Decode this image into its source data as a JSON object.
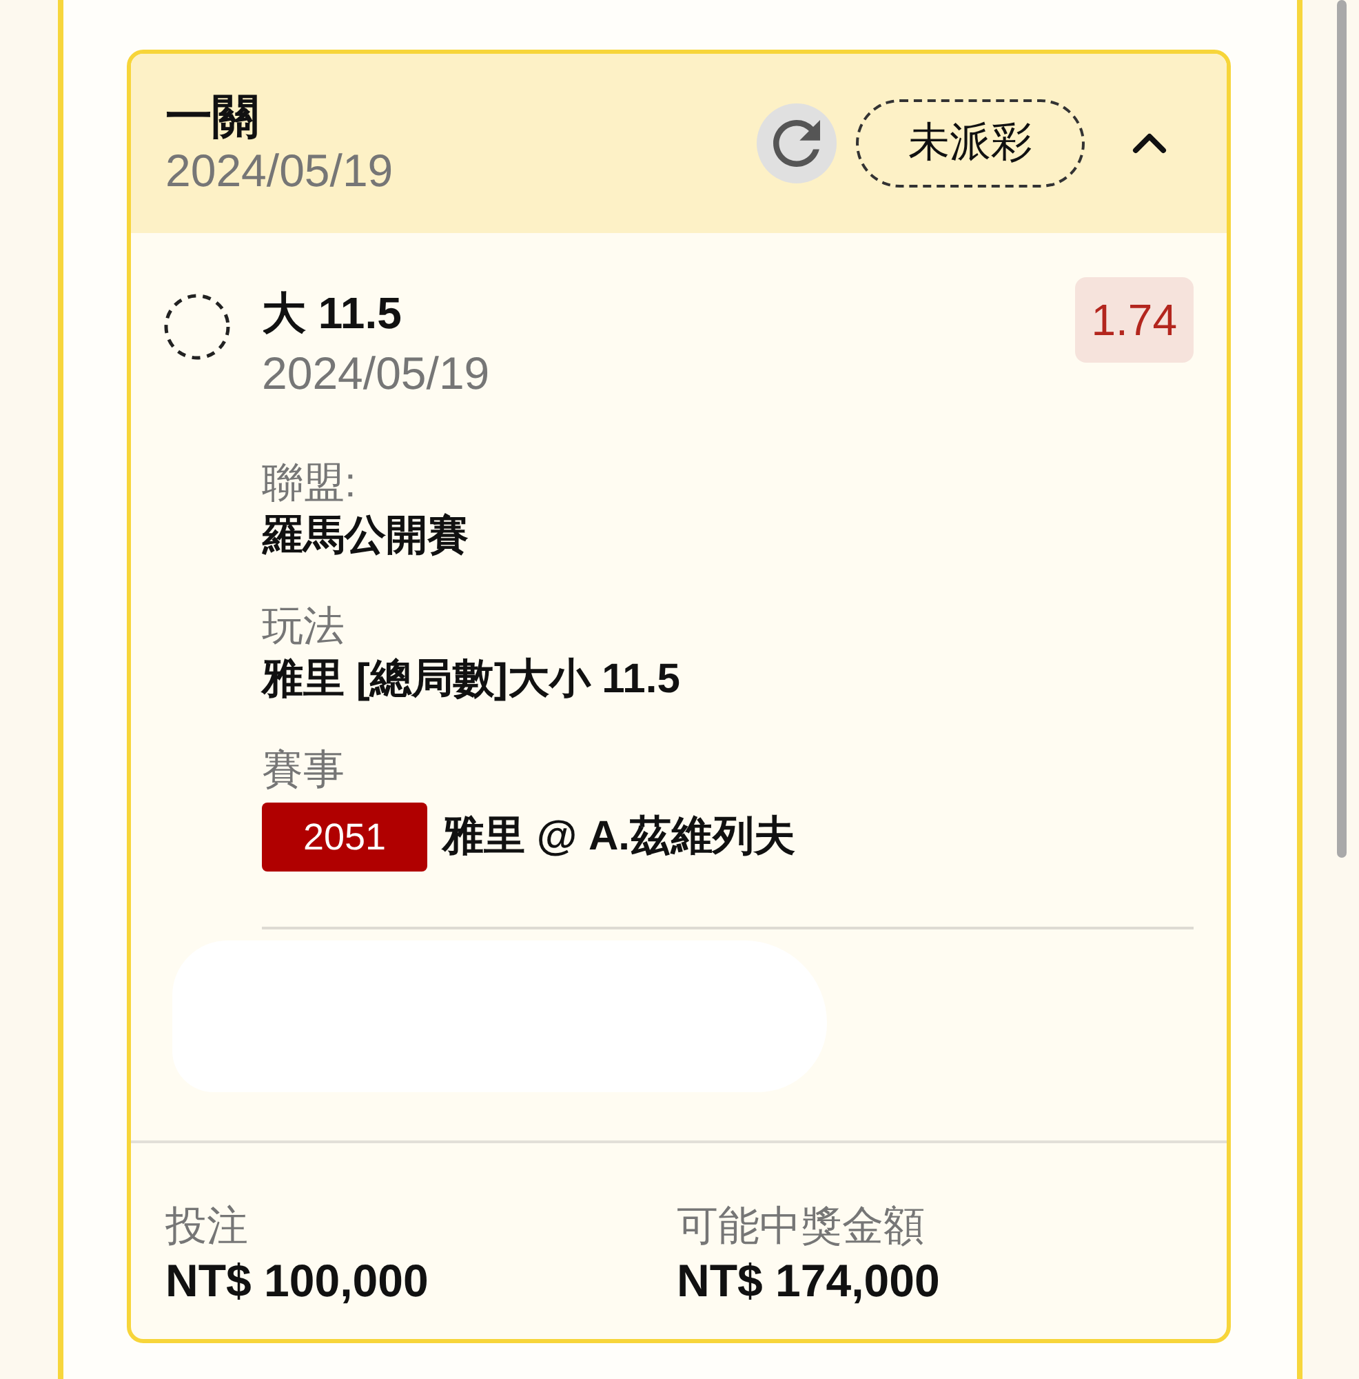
{
  "slip": {
    "title": "一關",
    "date": "2024/05/19",
    "status": "未派彩",
    "expanded": true
  },
  "selection": {
    "name": "大 11.5",
    "date": "2024/05/19",
    "odds": "1.74"
  },
  "details": [
    {
      "kind": "text",
      "label": "聯盟:",
      "value": "羅馬公開賽"
    },
    {
      "kind": "text",
      "label": "玩法",
      "value": "雅里 [總局數]大小 11.5"
    },
    {
      "kind": "event",
      "label": "賽事",
      "code": "2051",
      "value": "雅里 @ A.茲維列夫"
    }
  ],
  "footer": [
    {
      "label": "投注",
      "amount": "NT$ 100,000"
    },
    {
      "label": "可能中獎金額",
      "amount": "NT$ 174,000"
    }
  ]
}
